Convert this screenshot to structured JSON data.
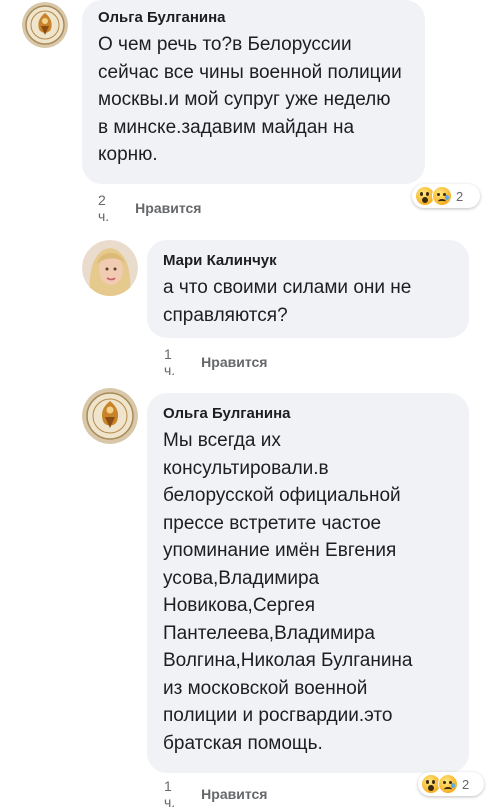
{
  "comments": [
    {
      "author": "Ольга Булганина",
      "text": "О чем речь то?в Белоруссии\nсейчас все чины военной полиции\nмосквы.и  мой супруг уже неделю\nв минске.задавим майдан на\nкорню.",
      "time": "2 ч.",
      "like_label": "Нравится",
      "reaction_count": "2",
      "avatar_icon": "emblem-avatar-icon"
    },
    {
      "author": "Мари Калинчук",
      "text": "а что своими силами они не\nсправляются?",
      "time": "1 ч.",
      "like_label": "Нравится",
      "avatar_icon": "blonde-woman-avatar"
    },
    {
      "author": "Ольга Булганина",
      "text": "Мы всегда их\nконсультировали.в\nбелорусской официальной\nпрессе встретите частое\nупоминание имён Евгения\nусова,Владимира\nНовикова,Сергея\nПантелеева,Владимира\nВолгина,Николая Булганина\nиз московской военной\nполиции и росгвардии.это\nбратская помощь.",
      "time": "1 ч.",
      "like_label": "Нравится",
      "reaction_count": "2",
      "avatar_icon": "emblem-avatar-icon"
    }
  ],
  "colors": {
    "bubble": "#f0f2f5",
    "text": "#1c1e21",
    "meta": "#65676b"
  }
}
